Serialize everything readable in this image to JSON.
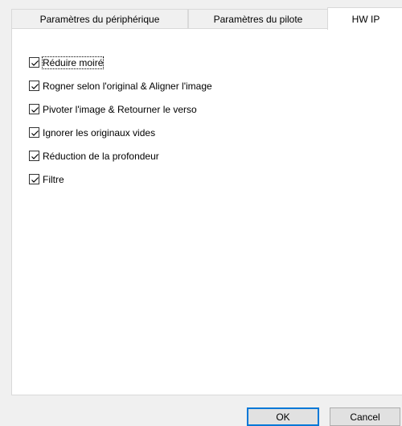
{
  "tabs": [
    {
      "label": "Paramètres du périphérique",
      "active": false
    },
    {
      "label": "Paramètres du pilote",
      "active": false
    },
    {
      "label": "HW IP",
      "active": true
    }
  ],
  "options": [
    {
      "label": "Réduire moiré",
      "checked": true
    },
    {
      "label": "Rogner selon l'original & Aligner l'image",
      "checked": true
    },
    {
      "label": "Pivoter l'image & Retourner le verso",
      "checked": true
    },
    {
      "label": "Ignorer les originaux vides",
      "checked": true
    },
    {
      "label": "Réduction de la profondeur",
      "checked": true
    },
    {
      "label": "Filtre",
      "checked": true
    }
  ],
  "buttons": {
    "ok_label": "OK",
    "cancel_label": "Cancel"
  },
  "colors": {
    "accent": "#0078d7",
    "panel": "#ffffff",
    "window": "#f0f0f0"
  }
}
